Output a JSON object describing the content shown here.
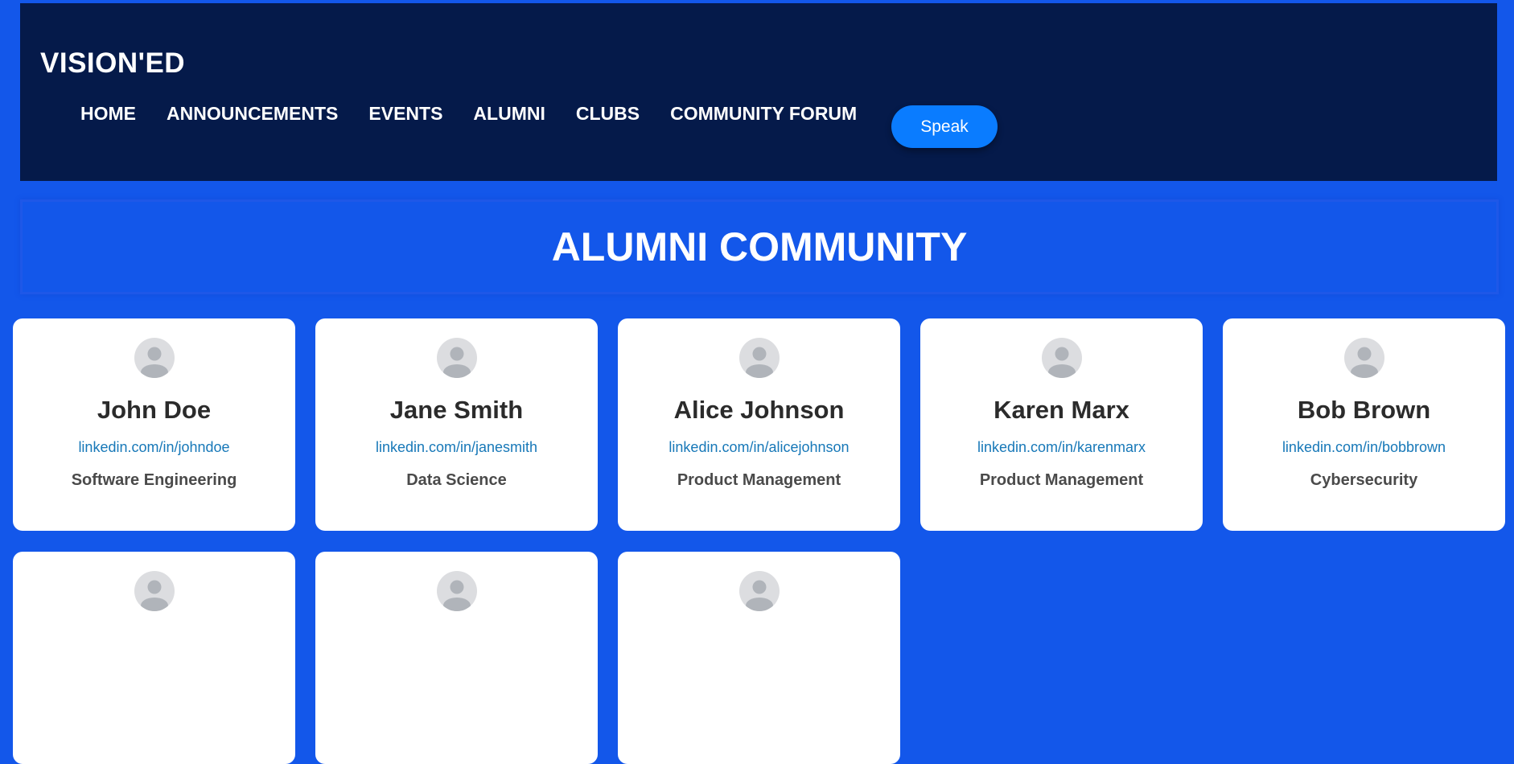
{
  "header": {
    "logo": "VISION'ED",
    "nav": [
      "HOME",
      "ANNOUNCEMENTS",
      "EVENTS",
      "ALUMNI",
      "CLUBS",
      "COMMUNITY FORUM"
    ],
    "speak_label": "Speak"
  },
  "main": {
    "title": "ALUMNI COMMUNITY",
    "alumni": [
      {
        "name": "John Doe",
        "linkedin": "linkedin.com/in/johndoe",
        "field": "Software Engineering"
      },
      {
        "name": "Jane Smith",
        "linkedin": "linkedin.com/in/janesmith",
        "field": "Data Science"
      },
      {
        "name": "Alice Johnson",
        "linkedin": "linkedin.com/in/alicejohnson",
        "field": "Product Management"
      },
      {
        "name": "Karen Marx",
        "linkedin": "linkedin.com/in/karenmarx",
        "field": "Product Management"
      },
      {
        "name": "Bob Brown",
        "linkedin": "linkedin.com/in/bobbrown",
        "field": "Cybersecurity"
      },
      {
        "name": "",
        "linkedin": "",
        "field": ""
      },
      {
        "name": "",
        "linkedin": "",
        "field": ""
      },
      {
        "name": "",
        "linkedin": "",
        "field": ""
      }
    ]
  },
  "colors": {
    "background": "#1357ea",
    "header": "#051a4a",
    "button": "#0a7cff",
    "link": "#1778b8"
  },
  "icons": {
    "avatar": "user-avatar-icon"
  }
}
